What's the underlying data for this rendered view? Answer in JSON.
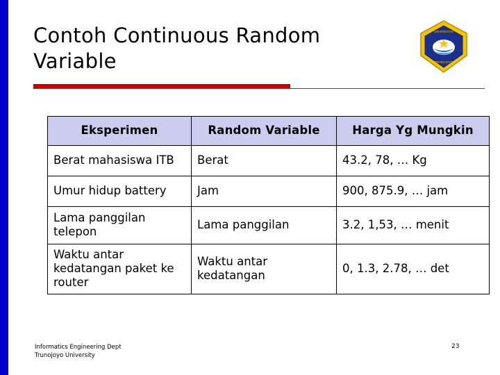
{
  "slide": {
    "title": "Contoh Continuous Random Variable",
    "page_number": "23",
    "accent_color": "#cc0000",
    "left_bar_color": "#0000cc",
    "header_fill": "#ccccee"
  },
  "logo": {
    "name": "trunojoyo-university-logo",
    "outer_color": "#f5c400",
    "inner_color": "#1b2f8c",
    "top_text": "UNIVERSITAS",
    "bottom_text": "TRUNOJOYO"
  },
  "table": {
    "headers": [
      "Eksperimen",
      "Random Variable",
      "Harga Yg Mungkin"
    ],
    "rows": [
      [
        "Berat mahasiswa ITB",
        "Berat",
        "43.2, 78, … Kg"
      ],
      [
        "Umur hidup battery",
        "Jam",
        "900, 875.9, … jam"
      ],
      [
        "Lama panggilan telepon",
        "Lama panggilan",
        "3.2, 1,53, … menit"
      ],
      [
        "Waktu antar kedatangan paket ke router",
        "Waktu antar kedatangan",
        "0, 1.3, 2.78, … det"
      ]
    ]
  },
  "footer": {
    "line1": "Informatics Engineering Dept",
    "line2": "Trunojoyo University"
  }
}
